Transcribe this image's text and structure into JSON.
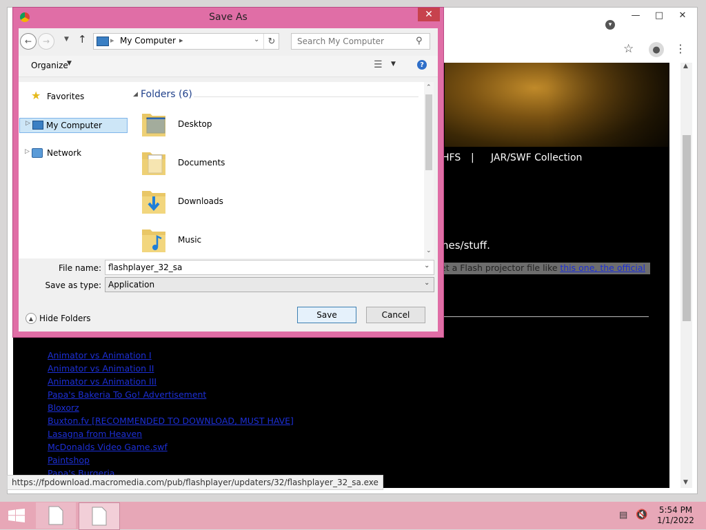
{
  "browser": {
    "nav": {
      "hfs": "HFS",
      "sep": "|",
      "jar": "JAR/SWF Collection"
    },
    "text_games": "nes/stuff.",
    "text_projector": "et a Flash projector file like",
    "text_link_one": "this one, the official",
    "links": [
      "Animator vs Animation I",
      "Animator vs Animation II",
      "Animator vs Animation III",
      "Papa's Bakeria To Go! Advertisement",
      "Bloxorz",
      "Buxton.fv [RECOMMENDED TO DOWNLOAD, MUST HAVE]",
      "Lasagna from Heaven",
      "McDonalds Video Game.swf",
      "Paintshop",
      "Papa's Burgeria"
    ],
    "status_url": "https://fpdownload.macromedia.com/pub/flashplayer/updaters/32/flashplayer_32_sa.exe"
  },
  "dialog": {
    "title": "Save As",
    "breadcrumb": "My Computer",
    "search_placeholder": "Search My Computer",
    "organize": "Organize",
    "nav": {
      "favorites": "Favorites",
      "my_computer": "My Computer",
      "network": "Network"
    },
    "folders_header": "Folders (6)",
    "folders": [
      "Desktop",
      "Documents",
      "Downloads",
      "Music"
    ],
    "file_name_label": "File name:",
    "file_name_value": "flashplayer_32_sa",
    "save_type_label": "Save as type:",
    "save_type_value": "Application",
    "hide_folders": "Hide Folders",
    "save_label": "Save",
    "cancel_label": "Cancel"
  },
  "taskbar": {
    "time": "5:54 PM",
    "date": "1/1/2022"
  },
  "colors": {
    "dialog_frame": "#e06ea6",
    "taskbar": "#e7a7b7",
    "link": "#1c2fd6",
    "close": "#c7424d"
  }
}
